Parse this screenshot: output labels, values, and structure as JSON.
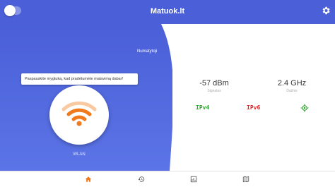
{
  "app": {
    "title": "Matuok.lt"
  },
  "left": {
    "default_label": "Numatytoji",
    "tooltip": "Paspauskite mygtuką, kad pradėtumėte matavimą dabar!",
    "network_label": "WLAN"
  },
  "stats": [
    {
      "value": "-57 dBm",
      "label": "Signalas"
    },
    {
      "value": "2.4 GHz",
      "label": "Dažnis"
    }
  ],
  "protocols": {
    "ipv4": "IPv4",
    "ipv6": "IPv6"
  },
  "colors": {
    "accent": "#4a5fd8",
    "wifi": "#f07a1c",
    "ipv4": "#29a329",
    "ipv6": "#e02020",
    "locate": "#29a329",
    "nav_active": "#f07a1c",
    "nav_inactive": "#555555"
  },
  "icons": {
    "settings": "gear-icon",
    "wifi": "wifi-icon",
    "locate": "crosshair-icon",
    "nav": [
      "home-icon",
      "history-icon",
      "chart-icon",
      "map-icon"
    ]
  }
}
